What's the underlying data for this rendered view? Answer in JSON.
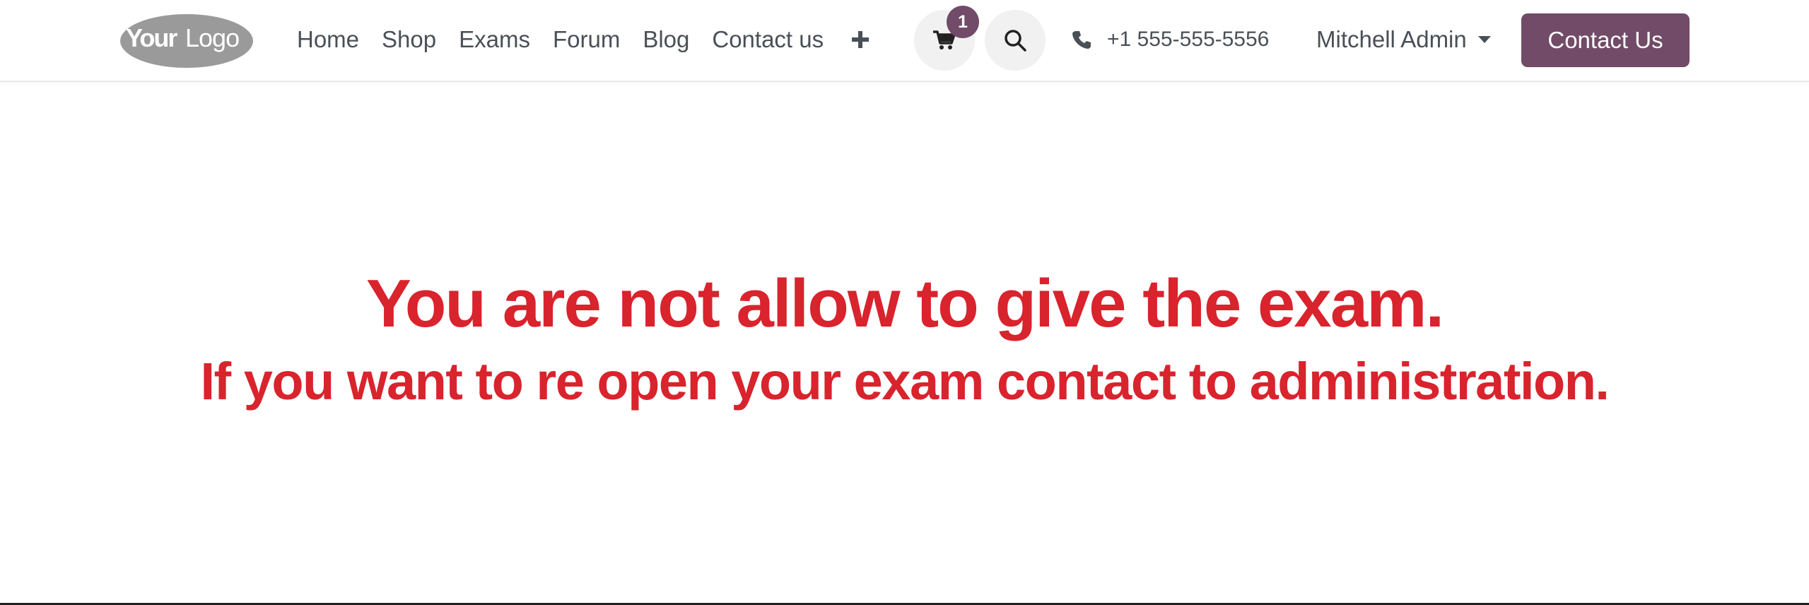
{
  "brand": {
    "logo_text_bold": "Your",
    "logo_text_light": "Logo",
    "accent_color": "#714b67",
    "error_color": "#d9232d"
  },
  "nav": {
    "items": [
      {
        "label": "Home"
      },
      {
        "label": "Shop"
      },
      {
        "label": "Exams"
      },
      {
        "label": "Forum"
      },
      {
        "label": "Blog"
      },
      {
        "label": "Contact us"
      }
    ],
    "add_icon": "plus-icon"
  },
  "cart": {
    "icon": "cart-icon",
    "count": "1"
  },
  "search": {
    "icon": "search-icon"
  },
  "phone": {
    "icon": "phone-icon",
    "number": "+1 555-555-5556"
  },
  "user": {
    "name": "Mitchell Admin"
  },
  "cta": {
    "label": "Contact Us"
  },
  "message": {
    "line1": "You are not allow to give the exam.",
    "line2": "If you want to re open your exam contact to administration."
  }
}
